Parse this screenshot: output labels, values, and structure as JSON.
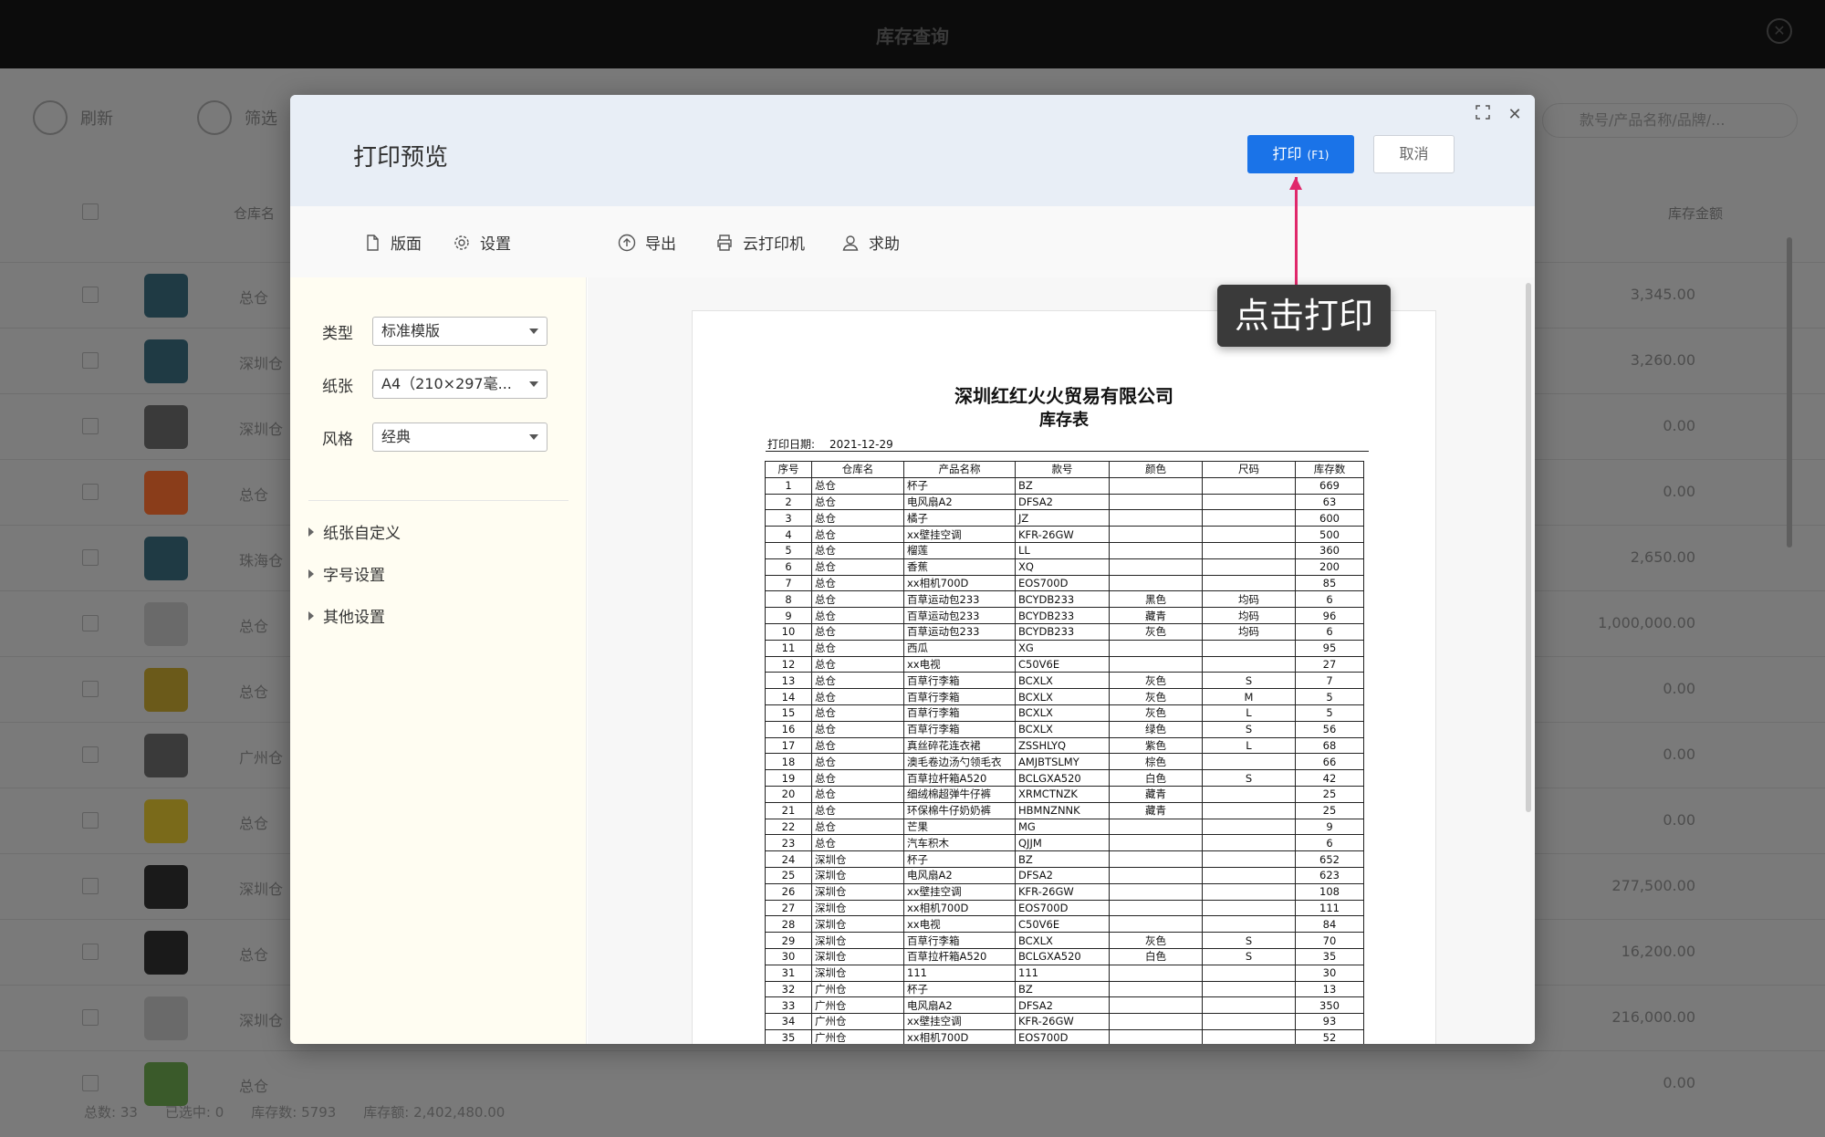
{
  "app": {
    "title": "库存查询",
    "toolbar": {
      "refresh_label": "刷新",
      "filter_label": "筛选",
      "search_placeholder": "款号/产品名称/品牌/..."
    },
    "columns": {
      "warehouse": "仓库名",
      "amount": "库存金额"
    },
    "rows": [
      {
        "warehouse": "总仓",
        "amount": "3,345.00"
      },
      {
        "warehouse": "深圳仓",
        "amount": "3,260.00"
      },
      {
        "warehouse": "深圳仓",
        "amount": "0.00"
      },
      {
        "warehouse": "总仓",
        "amount": "0.00"
      },
      {
        "warehouse": "珠海仓",
        "amount": "2,650.00"
      },
      {
        "warehouse": "总仓",
        "amount": "1,000,000.00"
      },
      {
        "warehouse": "总仓",
        "amount": "0.00"
      },
      {
        "warehouse": "广州仓",
        "amount": "0.00"
      },
      {
        "warehouse": "总仓",
        "amount": "0.00"
      },
      {
        "warehouse": "深圳仓",
        "amount": "277,500.00"
      },
      {
        "warehouse": "总仓",
        "amount": "16,200.00"
      },
      {
        "warehouse": "深圳仓",
        "amount": "216,000.00"
      },
      {
        "warehouse": "总仓",
        "amount": "0.00"
      }
    ],
    "footer": {
      "total": "总数: 33",
      "selected": "已选中: 0",
      "stock_qty": "库存数: 5793",
      "stock_amount": "库存额: 2,402,480.00"
    }
  },
  "modal": {
    "title": "打印预览",
    "print_label": "打印",
    "print_shortcut": "(F1)",
    "cancel_label": "取消",
    "toolbar": {
      "layout": "版面",
      "settings": "设置",
      "export": "导出",
      "cloud_printer": "云打印机",
      "help": "求助"
    },
    "settings": {
      "type_label": "类型",
      "type_value": "标准模版",
      "paper_label": "纸张",
      "paper_value": "A4（210×297毫...",
      "style_label": "风格",
      "style_value": "经典",
      "sections": [
        "纸张自定义",
        "字号设置",
        "其他设置"
      ]
    }
  },
  "document": {
    "company": "深圳红红火火贸易有限公司",
    "title": "库存表",
    "date_label": "打印日期:",
    "date_value": "2021-12-29",
    "headers": [
      "序号",
      "仓库名",
      "产品名称",
      "款号",
      "颜色",
      "尺码",
      "库存数"
    ],
    "rows": [
      [
        "1",
        "总仓",
        "杯子",
        "BZ",
        "",
        "",
        "669"
      ],
      [
        "2",
        "总仓",
        "电风扇A2",
        "DFSA2",
        "",
        "",
        "63"
      ],
      [
        "3",
        "总仓",
        "橘子",
        "JZ",
        "",
        "",
        "600"
      ],
      [
        "4",
        "总仓",
        "xx壁挂空调",
        "KFR-26GW",
        "",
        "",
        "500"
      ],
      [
        "5",
        "总仓",
        "榴莲",
        "LL",
        "",
        "",
        "360"
      ],
      [
        "6",
        "总仓",
        "香蕉",
        "XQ",
        "",
        "",
        "200"
      ],
      [
        "7",
        "总仓",
        "xx相机700D",
        "EOS700D",
        "",
        "",
        "85"
      ],
      [
        "8",
        "总仓",
        "百草运动包233",
        "BCYDB233",
        "黑色",
        "均码",
        "6"
      ],
      [
        "9",
        "总仓",
        "百草运动包233",
        "BCYDB233",
        "藏青",
        "均码",
        "96"
      ],
      [
        "10",
        "总仓",
        "百草运动包233",
        "BCYDB233",
        "灰色",
        "均码",
        "6"
      ],
      [
        "11",
        "总仓",
        "西瓜",
        "XG",
        "",
        "",
        "95"
      ],
      [
        "12",
        "总仓",
        "xx电视",
        "C50V6E",
        "",
        "",
        "27"
      ],
      [
        "13",
        "总仓",
        "百草行李箱",
        "BCXLX",
        "灰色",
        "S",
        "7"
      ],
      [
        "14",
        "总仓",
        "百草行李箱",
        "BCXLX",
        "灰色",
        "M",
        "5"
      ],
      [
        "15",
        "总仓",
        "百草行李箱",
        "BCXLX",
        "灰色",
        "L",
        "5"
      ],
      [
        "16",
        "总仓",
        "百草行李箱",
        "BCXLX",
        "绿色",
        "S",
        "56"
      ],
      [
        "17",
        "总仓",
        "真丝碎花连衣裙",
        "ZSSHLYQ",
        "紫色",
        "L",
        "68"
      ],
      [
        "18",
        "总仓",
        "澳毛卷边汤勺领毛衣",
        "AMJBTSLMY",
        "棕色",
        "",
        "66"
      ],
      [
        "19",
        "总仓",
        "百草拉杆箱A520",
        "BCLGXA520",
        "白色",
        "S",
        "42"
      ],
      [
        "20",
        "总仓",
        "细绒棉超弹牛仔裤",
        "XRMCTNZK",
        "藏青",
        "",
        "25"
      ],
      [
        "21",
        "总仓",
        "环保棉牛仔奶奶裤",
        "HBMNZNNK",
        "藏青",
        "",
        "25"
      ],
      [
        "22",
        "总仓",
        "芒果",
        "MG",
        "",
        "",
        "9"
      ],
      [
        "23",
        "总仓",
        "汽车积木",
        "QJJM",
        "",
        "",
        "6"
      ],
      [
        "24",
        "深圳仓",
        "杯子",
        "BZ",
        "",
        "",
        "652"
      ],
      [
        "25",
        "深圳仓",
        "电风扇A2",
        "DFSA2",
        "",
        "",
        "623"
      ],
      [
        "26",
        "深圳仓",
        "xx壁挂空调",
        "KFR-26GW",
        "",
        "",
        "108"
      ],
      [
        "27",
        "深圳仓",
        "xx相机700D",
        "EOS700D",
        "",
        "",
        "111"
      ],
      [
        "28",
        "深圳仓",
        "xx电视",
        "C50V6E",
        "",
        "",
        "84"
      ],
      [
        "29",
        "深圳仓",
        "百草行李箱",
        "BCXLX",
        "灰色",
        "S",
        "70"
      ],
      [
        "30",
        "深圳仓",
        "百草拉杆箱A520",
        "BCLGXA520",
        "白色",
        "S",
        "35"
      ],
      [
        "31",
        "深圳仓",
        "111",
        "111",
        "",
        "",
        "30"
      ],
      [
        "32",
        "广州仓",
        "杯子",
        "BZ",
        "",
        "",
        "13"
      ],
      [
        "33",
        "广州仓",
        "电风扇A2",
        "DFSA2",
        "",
        "",
        "350"
      ],
      [
        "34",
        "广州仓",
        "xx壁挂空调",
        "KFR-26GW",
        "",
        "",
        "93"
      ],
      [
        "35",
        "广州仓",
        "xx相机700D",
        "EOS700D",
        "",
        "",
        "52"
      ]
    ]
  },
  "annotation": {
    "callout": "点击打印"
  },
  "colors": {
    "accent": "#1a73e8",
    "annotation": "#e0286b",
    "header_bg": "#e8eef6",
    "left_panel_bg": "#fffdf2"
  }
}
